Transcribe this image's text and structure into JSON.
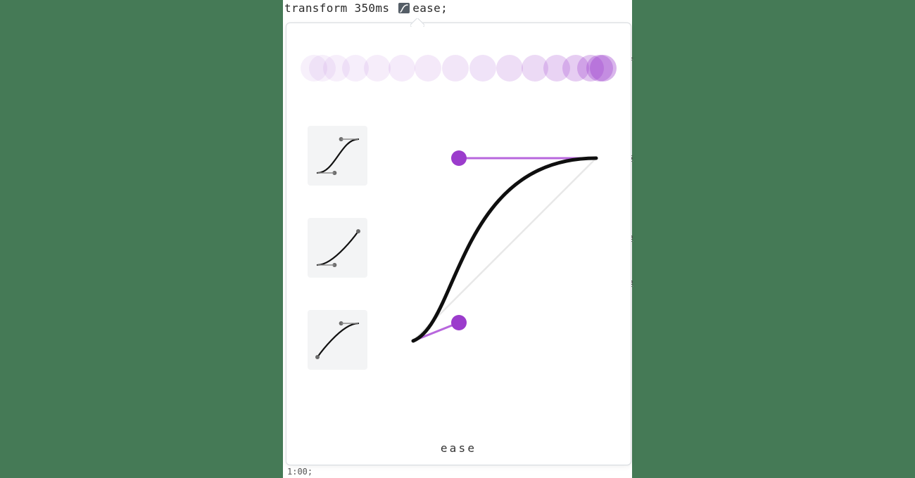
{
  "code_line": {
    "property": "transform",
    "duration": "350ms",
    "timing": "ease",
    "suffix": ";"
  },
  "swatch_icon": "easing-curve-icon",
  "popover": {
    "current_name": "ease",
    "presets": [
      {
        "id": "ease-in-out",
        "points": [
          0.42,
          0,
          0.58,
          1
        ]
      },
      {
        "id": "ease-in",
        "points": [
          0.42,
          0,
          1,
          1
        ]
      },
      {
        "id": "ease-out",
        "points": [
          0,
          0,
          0.58,
          1
        ]
      }
    ],
    "editor_curve": {
      "name": "ease",
      "p1": [
        0.25,
        0.1
      ],
      "p2": [
        0.25,
        1.0
      ]
    },
    "trail_steps": 16,
    "colors": {
      "accent": "#9b3ccc",
      "accent_light": "#b867dd",
      "curve": "#0f0f0f",
      "guide": "#e8e8e8"
    }
  },
  "page_hints": {
    "right_74": "L",
    "right_218": "s",
    "right_332": "e",
    "right_396": "e"
  },
  "bottom_fragment": "1:00;"
}
